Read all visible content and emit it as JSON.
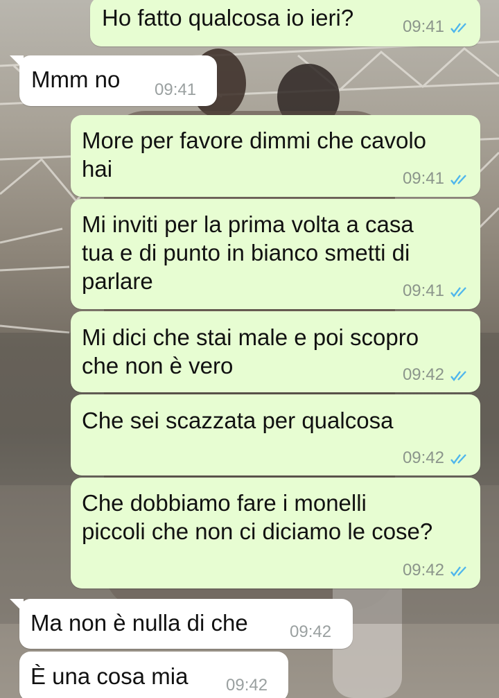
{
  "messages": [
    {
      "direction": "out",
      "text": "Ho fatto qualcosa io ieri?",
      "time": "09:41",
      "status": "read"
    },
    {
      "direction": "in",
      "text": "Mmm no",
      "time": "09:41"
    },
    {
      "direction": "out",
      "text": "More per favore dimmi che cavolo\nhai",
      "time": "09:41",
      "status": "read"
    },
    {
      "direction": "out",
      "text": "Mi inviti per la prima volta a casa\ntua e di punto in bianco smetti di\nparlare",
      "time": "09:41",
      "status": "read"
    },
    {
      "direction": "out",
      "text": "Mi dici che stai male e poi scopro\nche non è vero",
      "time": "09:42",
      "status": "read"
    },
    {
      "direction": "out",
      "text": "Che sei scazzata per qualcosa",
      "time": "09:42",
      "status": "read"
    },
    {
      "direction": "out",
      "text": "Che dobbiamo fare i monelli\npiccoli che non ci diciamo le cose?",
      "time": "09:42",
      "status": "read"
    },
    {
      "direction": "in",
      "text": "Ma non è nulla di che",
      "time": "09:42"
    },
    {
      "direction": "in",
      "text": "È una cosa mia",
      "time": "09:42"
    }
  ],
  "colors": {
    "outgoing_bubble": "#e7fdd2",
    "incoming_bubble": "#ffffff",
    "read_ticks": "#4fb6ec",
    "timestamp": "#8b958b"
  },
  "icons": {
    "read_status": "double-check-icon"
  }
}
